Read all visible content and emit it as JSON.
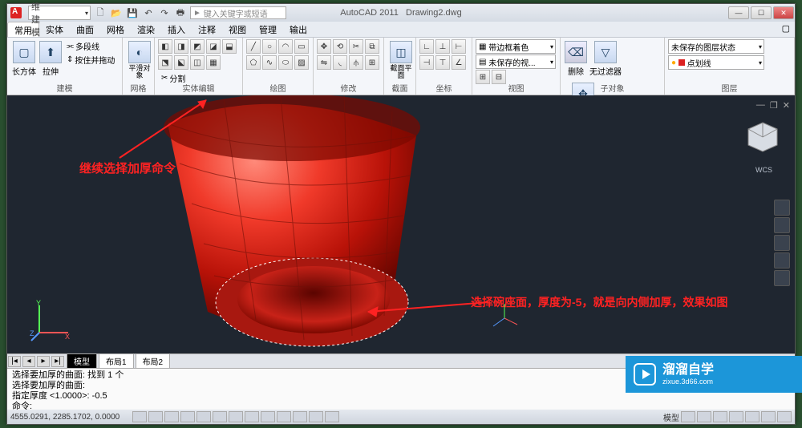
{
  "app": {
    "title": "AutoCAD 2011",
    "document": "Drawing2.dwg",
    "workspace": "三维建模",
    "search_placeholder": "键入关键字或短语"
  },
  "menu": {
    "tabs": [
      "常用",
      "实体",
      "曲面",
      "网格",
      "渲染",
      "插入",
      "注释",
      "视图",
      "管理",
      "输出"
    ],
    "active": 0
  },
  "ribbon": {
    "panel_modeling": {
      "label": "建模",
      "box": "长方体",
      "extrude": "拉伸",
      "polyline": "多段线",
      "presspull": "按住并拖动"
    },
    "panel_mesh": {
      "label": "网格",
      "smooth": "平滑对象"
    },
    "panel_solidedit": {
      "label": "实体编辑",
      "split": "分割"
    },
    "panel_draw": {
      "label": "绘图"
    },
    "panel_modify": {
      "label": "修改"
    },
    "panel_section": {
      "label": "截面",
      "sec": "截面平面"
    },
    "panel_coord": {
      "label": "坐标"
    },
    "panel_view": {
      "label": "视图",
      "bylayer": "带边框着色",
      "unsaved": "未保存的视..."
    },
    "panel_filter": {
      "label": "子对象",
      "delete": "删除",
      "nofilter": "无过滤器",
      "move": "移动小控件"
    },
    "panel_layer": {
      "label": "图层",
      "state": "未保存的图层状态",
      "cur": "点划线"
    }
  },
  "annotations": {
    "a1": "继续选择加厚命令",
    "a2": "选择碗座面，厚度为-5，就是向内侧加厚，效果如图"
  },
  "viewcube": {
    "wcs": "WCS"
  },
  "bottom_tabs": {
    "model": "模型",
    "layout1": "布局1",
    "layout2": "布局2"
  },
  "command": {
    "l1": "选择要加厚的曲面: 找到 1 个",
    "l2": "选择要加厚的曲面:",
    "l3": "指定厚度 <1.0000>: -0.5",
    "l4": "命令:"
  },
  "status": {
    "coords": "4555.0291, 2285.1702, 0.0000",
    "right": "模型"
  },
  "logo": {
    "brand": "溜溜自学",
    "url": "zixue.3d66.com"
  }
}
